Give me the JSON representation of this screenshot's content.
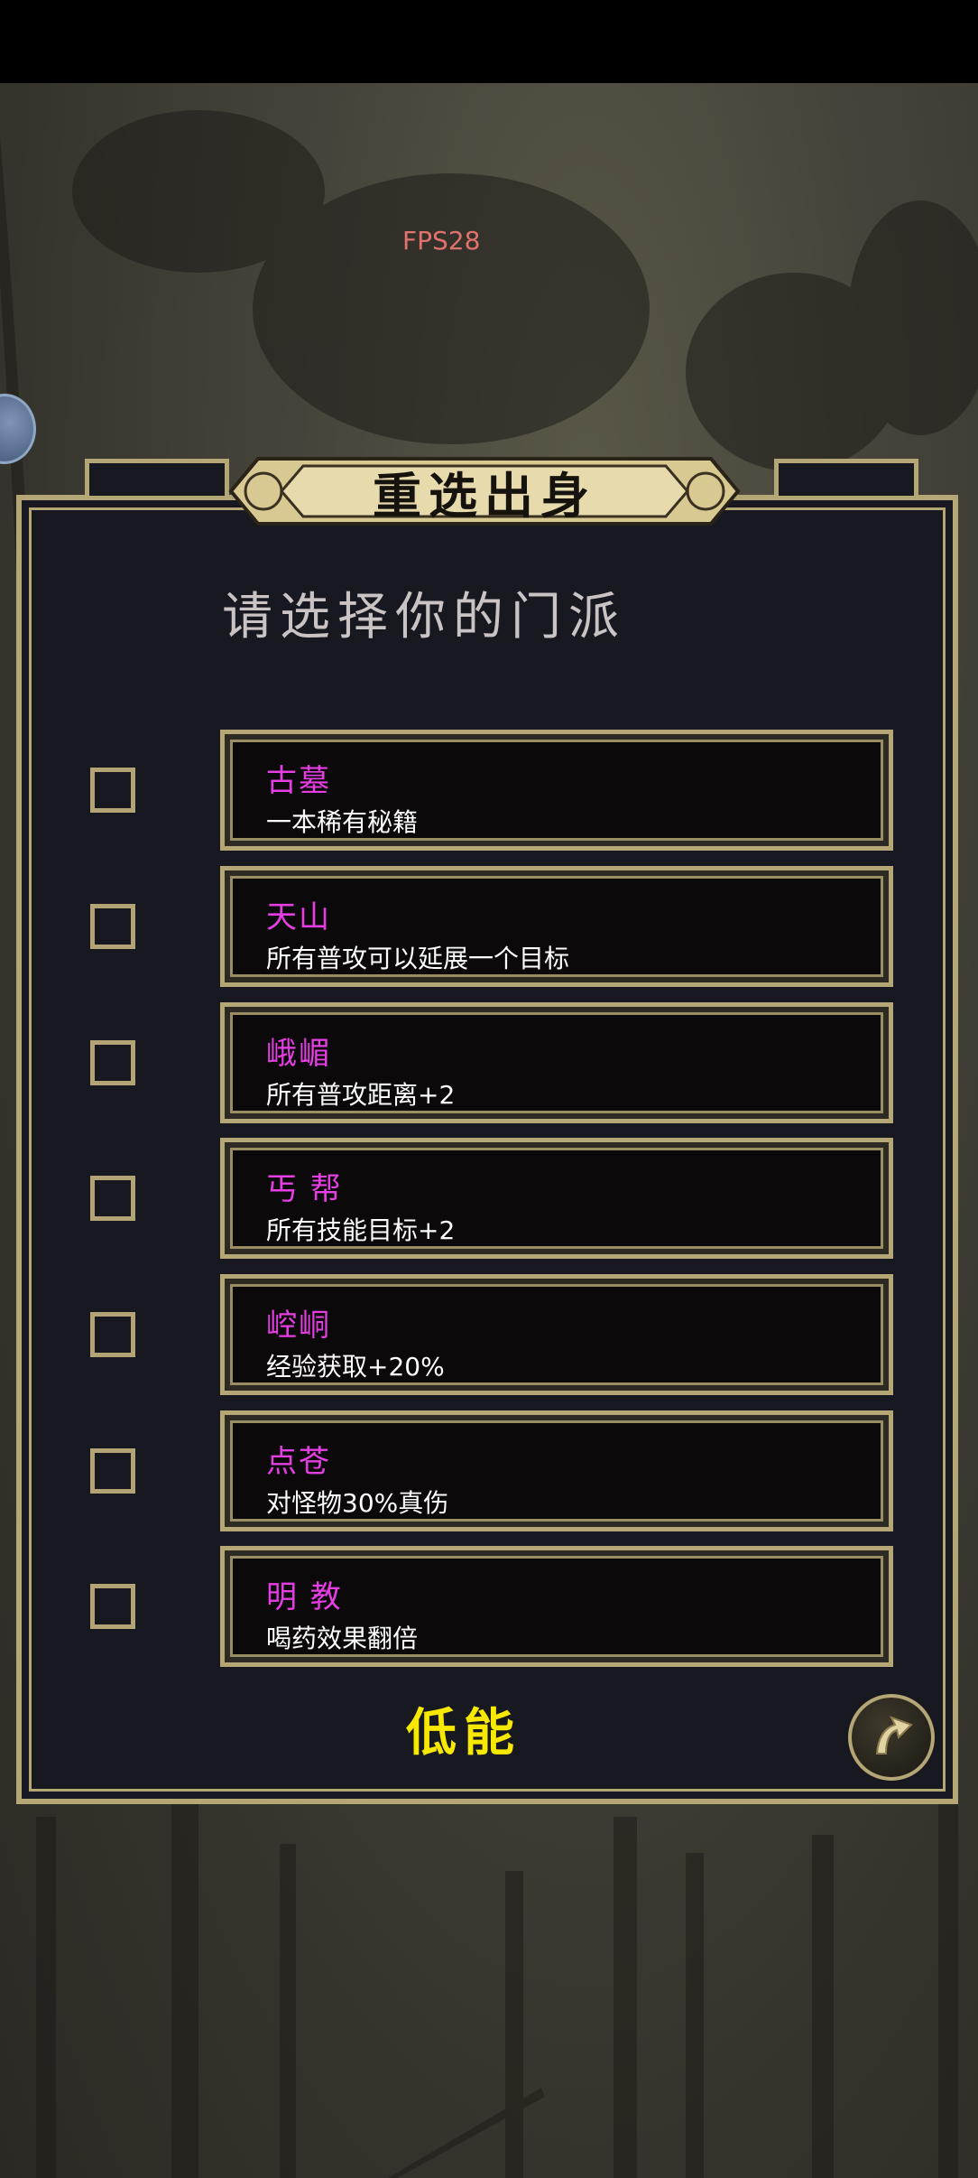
{
  "fps_label": "FPS28",
  "title": "重选出身",
  "subtitle": "请选择你的门派",
  "sects": [
    {
      "name": "古墓",
      "desc": "一本稀有秘籍"
    },
    {
      "name": "天山",
      "desc": "所有普攻可以延展一个目标"
    },
    {
      "name": "峨嵋",
      "desc": "所有普攻距离+2"
    },
    {
      "name": "丐 帮",
      "desc": "所有技能目标+2"
    },
    {
      "name": "崆峒",
      "desc": "经验获取+20%"
    },
    {
      "name": "点苍",
      "desc": "对怪物30%真伤"
    },
    {
      "name": "明 教",
      "desc": "喝药效果翻倍"
    }
  ],
  "footer_label": "低能",
  "icons": {
    "back": "back-arrow-icon",
    "side": "side-bubble-icon"
  },
  "colors": {
    "gold": "#b5a676",
    "panel": "#171820",
    "name": "#e53ee3",
    "footer": "#f7e800",
    "fps": "#e2726e"
  }
}
